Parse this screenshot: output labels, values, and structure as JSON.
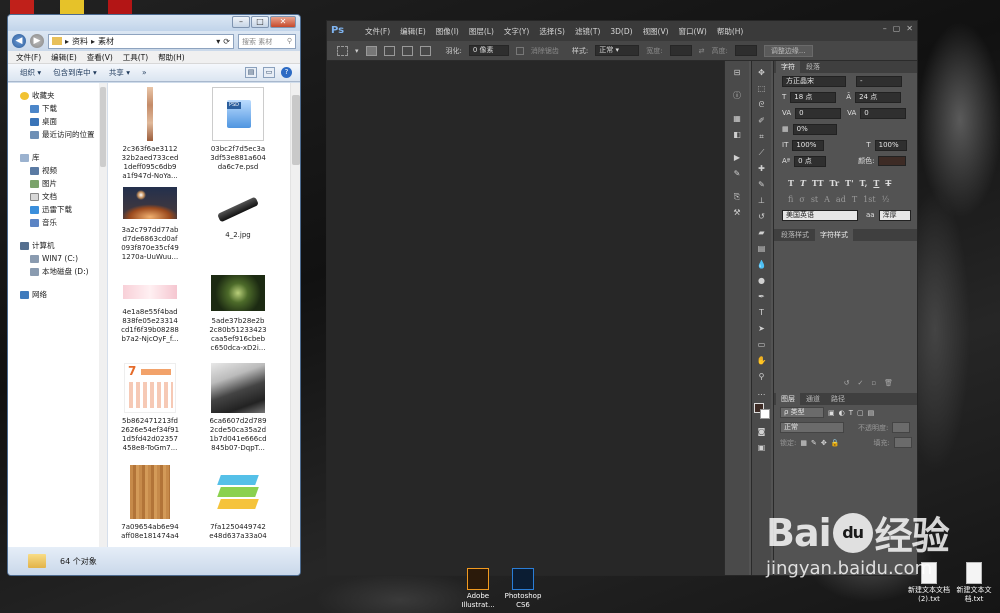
{
  "explorer": {
    "breadcrumb": [
      "资料",
      "素材"
    ],
    "search_placeholder": "搜索 素材",
    "menu": [
      "文件(F)",
      "编辑(E)",
      "查看(V)",
      "工具(T)",
      "帮助(H)"
    ],
    "toolbar": [
      "组织 ▾",
      "包含到库中 ▾",
      "共享 ▾",
      "»"
    ],
    "nav": {
      "favorites": "收藏夹",
      "fav_items": [
        "下载",
        "桌面",
        "最近访问的位置"
      ],
      "libraries": "库",
      "lib_items": [
        "视频",
        "图片",
        "文档",
        "迅雷下载",
        "音乐"
      ],
      "computer": "计算机",
      "drives": [
        "WIN7 (C:)",
        "本地磁盘 (D:)"
      ],
      "network": "网络"
    },
    "files": [
      {
        "name": [
          "2c363f6ae3112",
          "32b2aed733ced",
          "1deff095c6db9",
          "a1f947d-NoYa..."
        ],
        "kind": "strip"
      },
      {
        "name": [
          "03bc2f7d5ec3a",
          "3df53e881a604",
          "da6c7e.psd"
        ],
        "kind": "psd",
        "icon_label": "PSD"
      },
      {
        "name": [
          "3a2c797dd77ab",
          "d7de6863cd0af",
          "093f870e35cf49",
          "1270a-UuWuu..."
        ],
        "kind": "planet"
      },
      {
        "name": [
          "4_2.jpg"
        ],
        "kind": "flashlight"
      },
      {
        "name": [
          "4e1a8e55f4bad",
          "838fe05e23314",
          "cd1f6f39b08288",
          "b7a2-NjcOyF_f..."
        ],
        "kind": "pink"
      },
      {
        "name": [
          "5ade37b28e2b",
          "2c80b51233423",
          "caa5ef916cbeb",
          "c650dca-xD2i..."
        ],
        "kind": "forest"
      },
      {
        "name": [
          "5b862471213fd",
          "2626e54ef34f91",
          "1d5fd42d02357",
          "458e8-ToGm7..."
        ],
        "kind": "calendar"
      },
      {
        "name": [
          "6ca6607d2d789",
          "2cde50ca35a2d",
          "1b7d041e666cd",
          "845b07-DqpT..."
        ],
        "kind": "temple"
      },
      {
        "name": [
          "7a09654ab6e94",
          "aff08e181474a4"
        ],
        "kind": "wood"
      },
      {
        "name": [
          "7fa1250449742",
          "e48d637a33a04"
        ],
        "kind": "layers"
      }
    ],
    "status_count": "64 个对象"
  },
  "photoshop": {
    "logo": "Ps",
    "menu": [
      "文件(F)",
      "编辑(E)",
      "图像(I)",
      "图层(L)",
      "文字(Y)",
      "选择(S)",
      "滤镜(T)",
      "3D(D)",
      "视图(V)",
      "窗口(W)",
      "帮助(H)"
    ],
    "options": {
      "feather_label": "羽化:",
      "feather_value": "0 像素",
      "antialias_label": "消除锯齿",
      "style_label": "样式:",
      "style_value": "正常",
      "width_label": "宽度:",
      "height_label": "高度:",
      "refine_button": "调整边缘..."
    },
    "character_panel": {
      "tabs": [
        "字符",
        "段落"
      ],
      "font_family": "方正晶宋",
      "font_style": "-",
      "font_size": "18 点",
      "leading": "24 点",
      "kerning": "0",
      "tracking": "0",
      "scale_pct": "0%",
      "vertical_scale": "100%",
      "horizontal_scale": "100%",
      "baseline": "0 点",
      "color_label": "颜色:",
      "type_styles": [
        "T",
        "T",
        "TT",
        "Tr",
        "T'",
        "T,",
        "T",
        "T"
      ],
      "type_styles2": [
        "fi",
        "σ",
        "st",
        "A",
        "ad",
        "T",
        "1st",
        "½"
      ],
      "language": "美国英语",
      "antialias": "浑厚"
    },
    "styles_panel_tabs": [
      "段落样式",
      "字符样式"
    ],
    "layers_panel": {
      "tabs": [
        "图层",
        "通道",
        "路径"
      ],
      "filter_kind": "ρ 类型",
      "blend_mode": "正常",
      "opacity_label": "不透明度:",
      "lock_label": "锁定:",
      "fill_label": "填充:"
    }
  },
  "taskbar": {
    "items": [
      {
        "label": [
          "Adobe",
          "Illustrat..."
        ],
        "color": "#f29a1f"
      },
      {
        "label": [
          "Photoshop",
          "CS6"
        ],
        "color": "#2a7dd6"
      }
    ]
  },
  "desktop_files": [
    {
      "label": [
        "新建文本文档",
        "(2).txt"
      ]
    },
    {
      "label": [
        "新建文本文",
        "档.txt"
      ]
    }
  ],
  "watermark": {
    "brand": "Bai",
    "brand_tail": "经验",
    "paw_text": "du",
    "url": "jingyan.baidu.com"
  }
}
